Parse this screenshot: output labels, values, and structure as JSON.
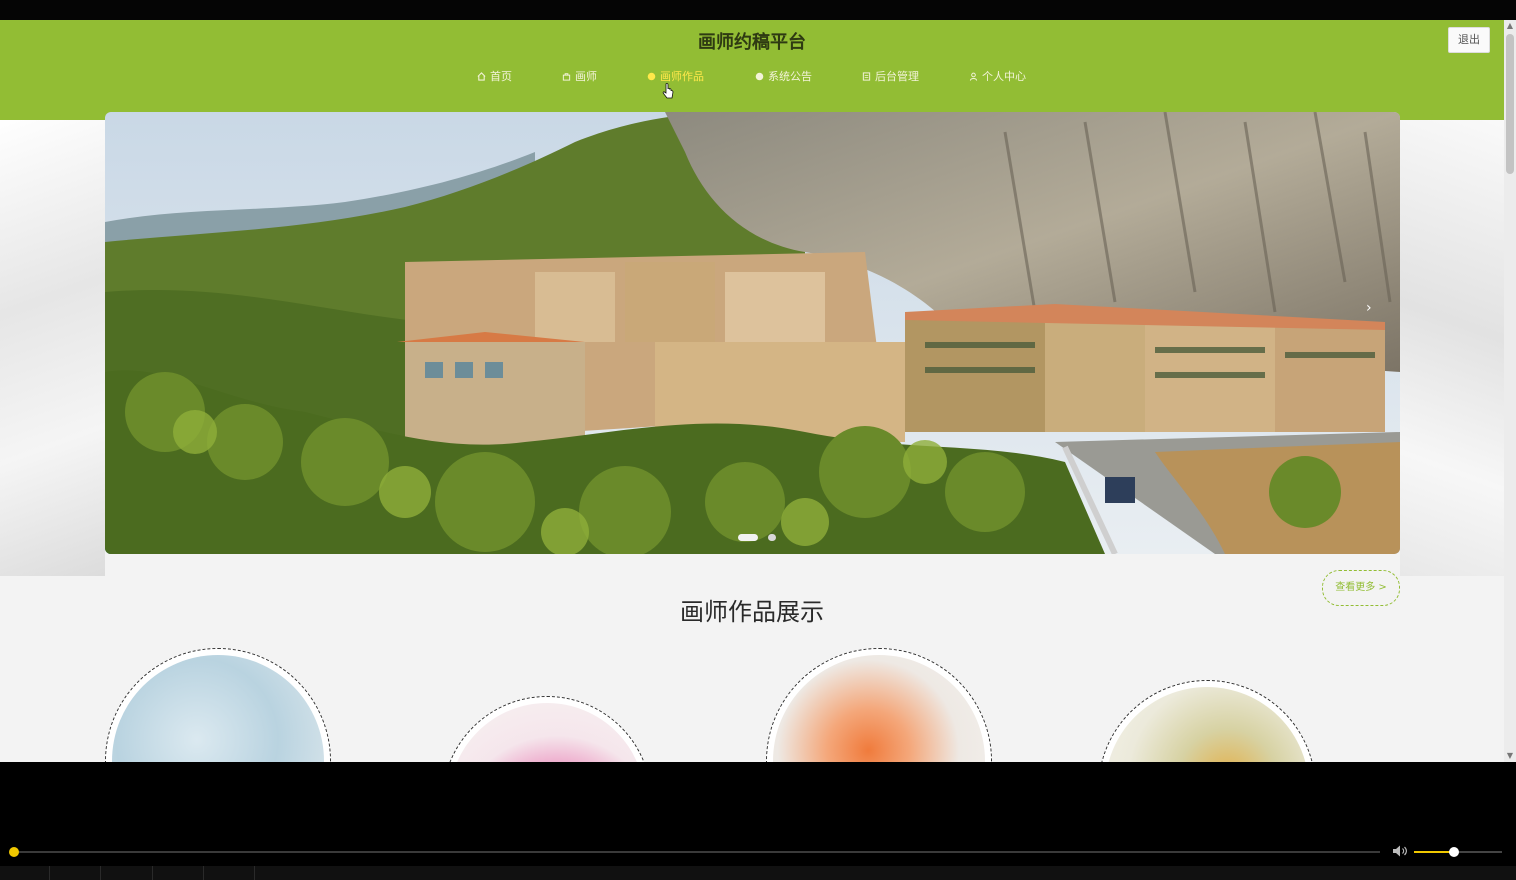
{
  "site": {
    "title": "画师约稿平台",
    "logout_label": "退出"
  },
  "nav": {
    "items": [
      {
        "label": "首页",
        "icon": "home-icon",
        "active": false
      },
      {
        "label": "画师",
        "icon": "bag-icon",
        "active": false
      },
      {
        "label": "画师作品",
        "icon": "circle-icon",
        "active": true
      },
      {
        "label": "系统公告",
        "icon": "circle-icon",
        "active": false
      },
      {
        "label": "后台管理",
        "icon": "document-icon",
        "active": false
      },
      {
        "label": "个人中心",
        "icon": "user-icon",
        "active": false
      }
    ]
  },
  "carousel": {
    "next_arrow": "›",
    "slide_count": 2,
    "active_slide": 1,
    "image_description": "hillside village below cliffs"
  },
  "section": {
    "title": "画师作品展示",
    "more_label": "查看更多 >"
  },
  "works": {
    "count": 4,
    "icon": "artwork-thumbnail"
  },
  "player": {
    "progress": 0.0,
    "volume": 0.45
  },
  "colors": {
    "brand_green": "#92bd34",
    "nav_active": "#ffe84a",
    "player_accent": "#f0c800"
  }
}
